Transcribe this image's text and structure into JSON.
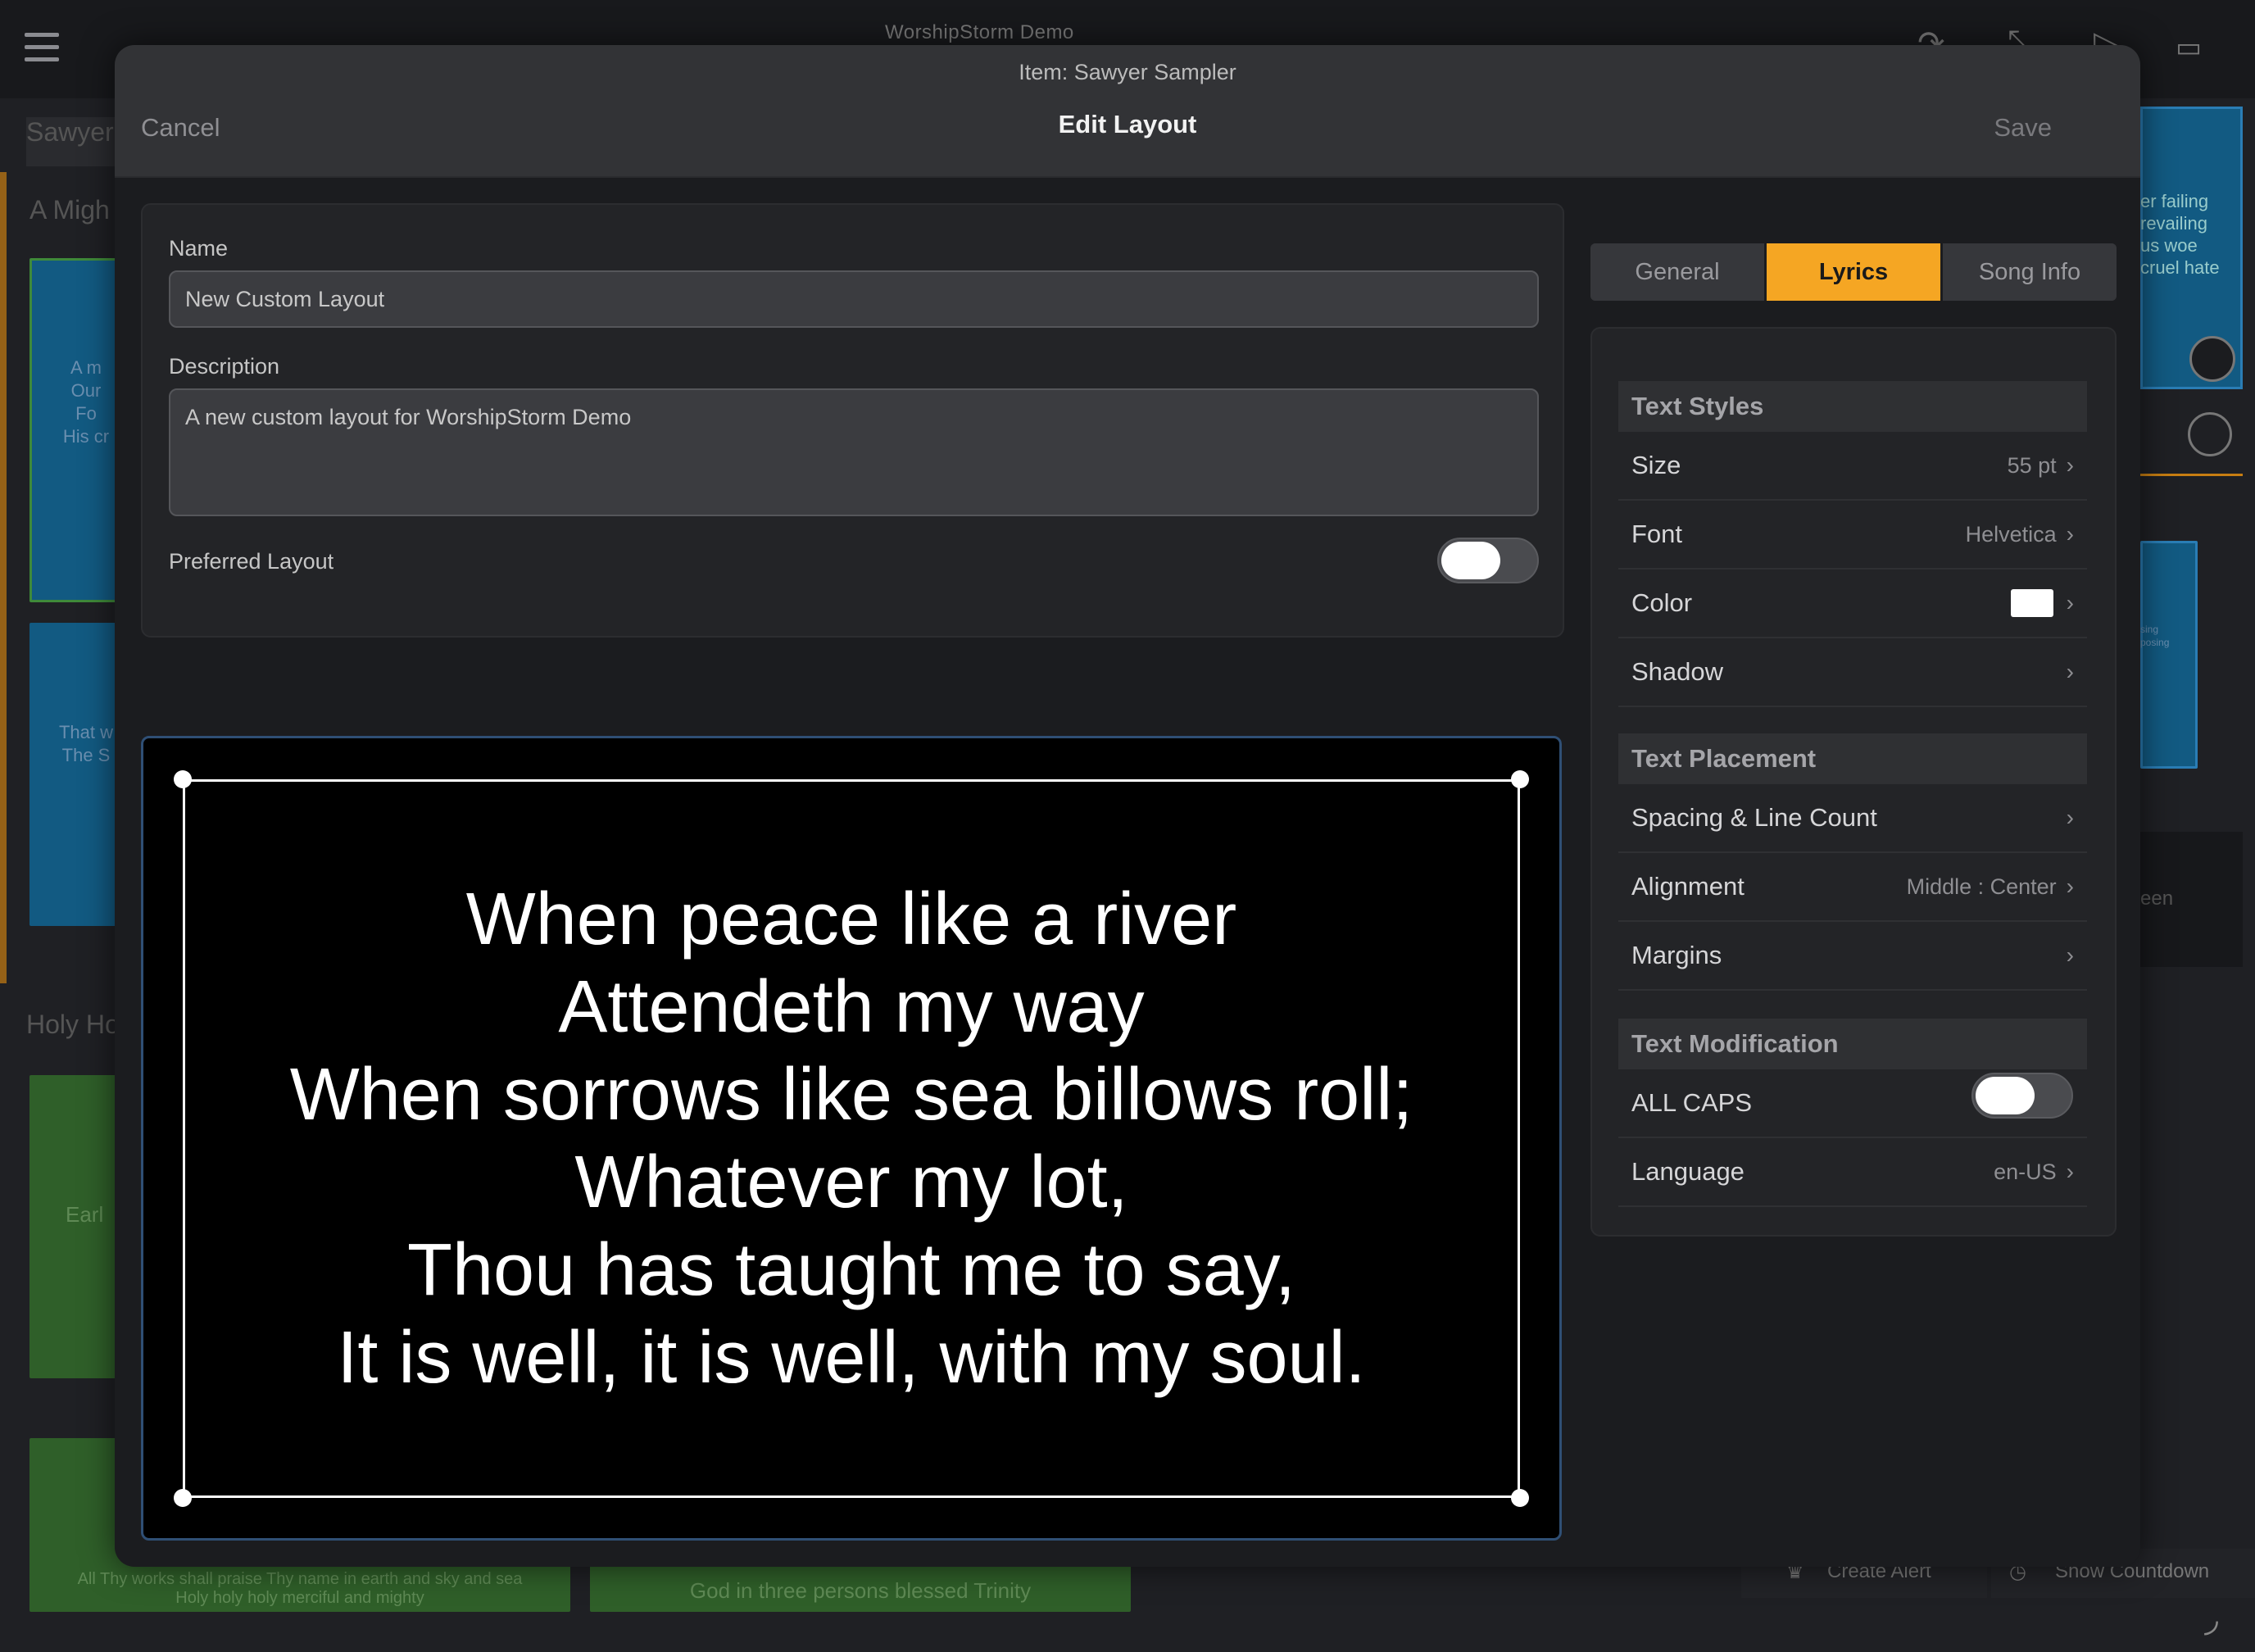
{
  "background": {
    "app_title": "WorshipStorm Demo",
    "sidebar_section_1": "Sawyer",
    "sidebar_item_1": "A Migh",
    "slide_1_text": [
      "A m",
      "Our",
      "Fo",
      "His cr"
    ],
    "slide_2_text": [
      "That w",
      "The S"
    ],
    "sidebar_section_2": "Holy Ho",
    "slide_3_text": "Earl",
    "slide_4_text": [
      "All Thy works shall praise Thy name in earth and sky and sea",
      "Holy holy holy merciful and mighty"
    ],
    "slide_5_text": "God in three persons blessed Trinity",
    "right_slide_text": [
      "er failing",
      "revailing",
      "us woe",
      "cruel hate"
    ],
    "right_small_text": [
      "sing",
      "posing"
    ],
    "right_screen_label": "een",
    "create_alert": "Create Alert",
    "show_countdown": "Show Countdown"
  },
  "modal": {
    "item_subtitle": "Item: Sawyer Sampler",
    "title": "Edit Layout",
    "cancel_label": "Cancel",
    "save_label": "Save"
  },
  "form": {
    "name_label": "Name",
    "name_value": "New Custom Layout",
    "description_label": "Description",
    "description_value": "A new custom layout for WorshipStorm Demo",
    "preferred_label": "Preferred Layout",
    "preferred_on": false
  },
  "preview": {
    "lyrics": [
      "When peace like a river",
      "Attendeth my way",
      "When sorrows like sea billows roll;",
      "Whatever my lot,",
      "Thou has taught me to say,",
      "It is well, it is well, with my soul."
    ],
    "text_color": "#ffffff",
    "background_color": "#000000"
  },
  "tabs": [
    {
      "label": "General",
      "active": false
    },
    {
      "label": "Lyrics",
      "active": true
    },
    {
      "label": "Song Info",
      "active": false
    }
  ],
  "accent_color": "#f5a623",
  "settings": {
    "text_styles": {
      "header": "Text Styles",
      "size_label": "Size",
      "size_value": "55 pt",
      "font_label": "Font",
      "font_value": "Helvetica",
      "color_label": "Color",
      "color_value": "#ffffff",
      "shadow_label": "Shadow"
    },
    "text_placement": {
      "header": "Text Placement",
      "spacing_label": "Spacing & Line Count",
      "alignment_label": "Alignment",
      "alignment_value": "Middle : Center",
      "margins_label": "Margins"
    },
    "text_modification": {
      "header": "Text Modification",
      "allcaps_label": "ALL CAPS",
      "allcaps_on": false,
      "language_label": "Language",
      "language_value": "en-US"
    }
  }
}
